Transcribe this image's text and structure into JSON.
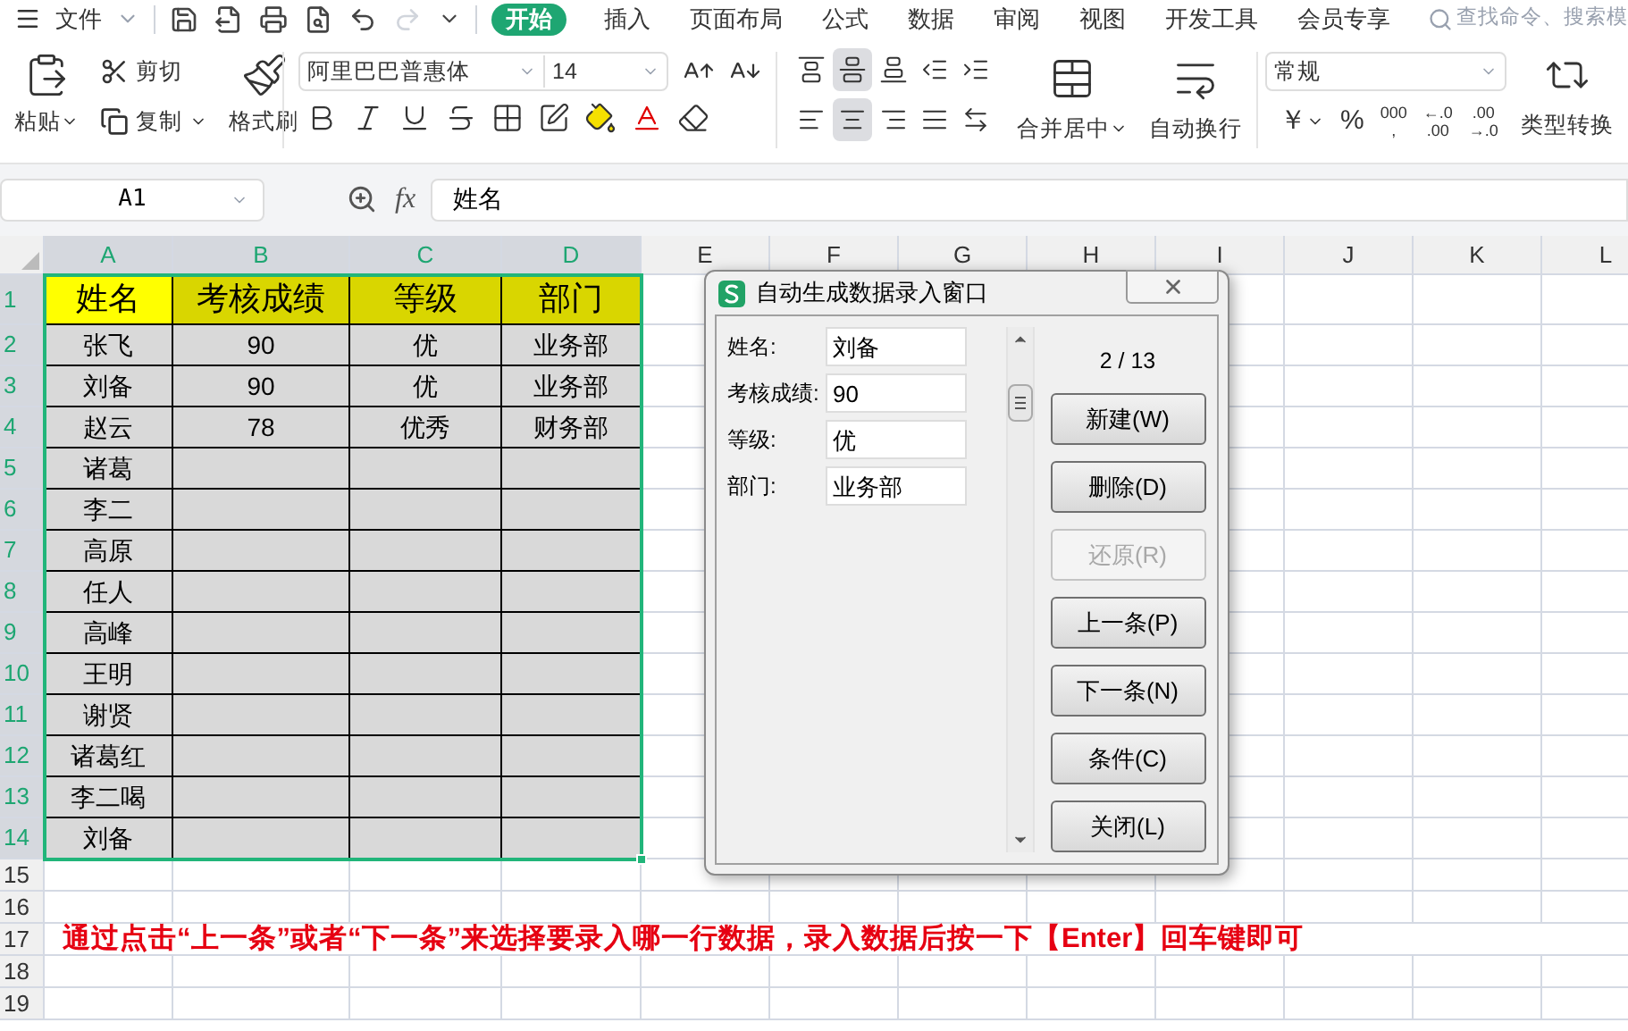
{
  "menu_bar": {
    "menu_label": "文件",
    "tabs": [
      {
        "label": "开始",
        "selected": true
      },
      {
        "label": "插入",
        "selected": false
      },
      {
        "label": "页面布局",
        "selected": false
      },
      {
        "label": "公式",
        "selected": false
      },
      {
        "label": "数据",
        "selected": false
      },
      {
        "label": "审阅",
        "selected": false
      },
      {
        "label": "视图",
        "selected": false
      },
      {
        "label": "开发工具",
        "selected": false
      },
      {
        "label": "会员专享",
        "selected": false
      }
    ],
    "search": {
      "placeholder": "查找命令、搜索模"
    }
  },
  "ribbon": {
    "paste": "粘贴",
    "cut": "剪切",
    "copy": "复制",
    "format_painter": "格式刷",
    "font_name": "阿里巴巴普惠体",
    "font_size": "14",
    "alignment": [
      {
        "kind": "top",
        "selected": false
      },
      {
        "kind": "middle",
        "selected": true
      },
      {
        "kind": "bottom",
        "selected": false
      },
      {
        "kind": "outdent",
        "selected": false
      },
      {
        "kind": "indent",
        "selected": false
      },
      {
        "kind": "left",
        "selected": false
      },
      {
        "kind": "center",
        "selected": true
      },
      {
        "kind": "right",
        "selected": false
      },
      {
        "kind": "justify",
        "selected": false
      },
      {
        "kind": "distributed",
        "selected": false
      }
    ],
    "merge": "合并居中",
    "wrap": "自动换行",
    "number_format": "常规",
    "number_buttons": [
      {
        "kind": "caret",
        "lines": [
          "￥"
        ]
      },
      {
        "kind": "plain",
        "lines": [
          "%"
        ]
      },
      {
        "kind": "plain",
        "lines": [
          "000",
          ","
        ]
      },
      {
        "kind": "plain",
        "lines": [
          "←.0",
          ".00"
        ]
      },
      {
        "kind": "plain",
        "lines": [
          ".00",
          "→.0"
        ]
      }
    ],
    "convert": "类型转换"
  },
  "formula_bar": {
    "name_box": "A1",
    "fx": "fx",
    "value": "姓名"
  },
  "sheet": {
    "columns": [
      {
        "letter": "A",
        "selected": true
      },
      {
        "letter": "B",
        "selected": true
      },
      {
        "letter": "C",
        "selected": true
      },
      {
        "letter": "D",
        "selected": true
      },
      {
        "letter": "E",
        "selected": false
      },
      {
        "letter": "F",
        "selected": false
      },
      {
        "letter": "G",
        "selected": false
      },
      {
        "letter": "H",
        "selected": false
      },
      {
        "letter": "I",
        "selected": false
      },
      {
        "letter": "J",
        "selected": false
      },
      {
        "letter": "K",
        "selected": false
      },
      {
        "letter": "L",
        "selected": false
      }
    ],
    "rows": [
      {
        "number": "1",
        "selected": true,
        "kind": "header",
        "cells": [
          {
            "text": "姓名",
            "active": true
          },
          {
            "text": "考核成绩",
            "active": false
          },
          {
            "text": "等级",
            "active": false
          },
          {
            "text": "部门",
            "active": false
          }
        ]
      },
      {
        "number": "2",
        "selected": true,
        "kind": "record",
        "cells": [
          {
            "text": "张飞",
            "active": false
          },
          {
            "text": "90",
            "active": false
          },
          {
            "text": "优",
            "active": false
          },
          {
            "text": "业务部",
            "active": false
          }
        ]
      },
      {
        "number": "3",
        "selected": true,
        "kind": "record",
        "cells": [
          {
            "text": "刘备",
            "active": false
          },
          {
            "text": "90",
            "active": false
          },
          {
            "text": "优",
            "active": false
          },
          {
            "text": "业务部",
            "active": false
          }
        ]
      },
      {
        "number": "4",
        "selected": true,
        "kind": "record",
        "cells": [
          {
            "text": "赵云",
            "active": false
          },
          {
            "text": "78",
            "active": false
          },
          {
            "text": "优秀",
            "active": false
          },
          {
            "text": "财务部",
            "active": false
          }
        ]
      },
      {
        "number": "5",
        "selected": true,
        "kind": "record",
        "cells": [
          {
            "text": "诸葛",
            "active": false
          }
        ]
      },
      {
        "number": "6",
        "selected": true,
        "kind": "record",
        "cells": [
          {
            "text": "李二",
            "active": false
          }
        ]
      },
      {
        "number": "7",
        "selected": true,
        "kind": "record",
        "cells": [
          {
            "text": "高原",
            "active": false
          }
        ]
      },
      {
        "number": "8",
        "selected": true,
        "kind": "record",
        "cells": [
          {
            "text": "任人",
            "active": false
          }
        ]
      },
      {
        "number": "9",
        "selected": true,
        "kind": "record",
        "cells": [
          {
            "text": "高峰",
            "active": false
          }
        ]
      },
      {
        "number": "10",
        "selected": true,
        "kind": "record",
        "cells": [
          {
            "text": "王明",
            "active": false
          }
        ]
      },
      {
        "number": "11",
        "selected": true,
        "kind": "record",
        "cells": [
          {
            "text": "谢贤",
            "active": false
          }
        ]
      },
      {
        "number": "12",
        "selected": true,
        "kind": "record",
        "cells": [
          {
            "text": "诸葛红",
            "active": false
          }
        ]
      },
      {
        "number": "13",
        "selected": true,
        "kind": "record",
        "cells": [
          {
            "text": "李二喝",
            "active": false
          }
        ]
      },
      {
        "number": "14",
        "selected": true,
        "kind": "record",
        "cells": [
          {
            "text": "刘备",
            "active": false
          }
        ]
      },
      {
        "number": "15",
        "selected": false,
        "kind": "blank"
      },
      {
        "number": "16",
        "selected": false,
        "kind": "blank"
      },
      {
        "number": "17",
        "selected": false,
        "kind": "note",
        "text": "通过点击“上一条”或者“下一条”来选择要录入哪一行数据，录入数据后按一下【Enter】回车键即可"
      },
      {
        "number": "18",
        "selected": false,
        "kind": "blank"
      },
      {
        "number": "19",
        "selected": false,
        "kind": "blank"
      }
    ]
  },
  "dialog": {
    "title": "自动生成数据录入窗口",
    "fields": [
      {
        "label": "姓名:",
        "value": "刘备"
      },
      {
        "label": "考核成绩:",
        "value": "90"
      },
      {
        "label": "等级:",
        "value": "优"
      },
      {
        "label": "部门:",
        "value": "业务部"
      }
    ],
    "record_counter": "2 / 13",
    "buttons": [
      {
        "label": "新建(W)",
        "disabled": false
      },
      {
        "label": "删除(D)",
        "disabled": false
      },
      {
        "label": "还原(R)",
        "disabled": true
      },
      {
        "label": "上一条(P)",
        "disabled": false
      },
      {
        "label": "下一条(N)",
        "disabled": false
      },
      {
        "label": "条件(C)",
        "disabled": false
      },
      {
        "label": "关闭(L)",
        "disabled": false
      }
    ]
  }
}
